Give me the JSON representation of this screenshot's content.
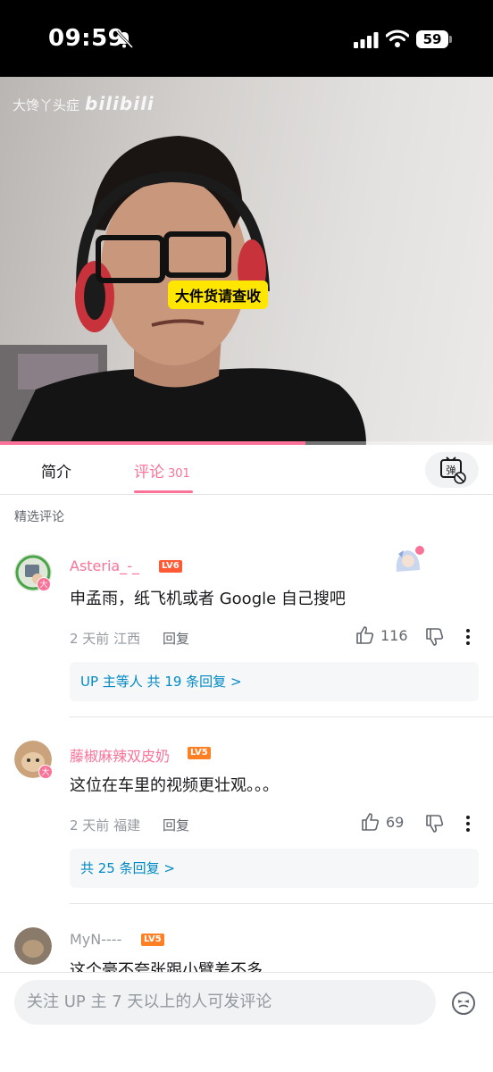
{
  "status_bar": {
    "time": "09:59",
    "battery": "59"
  },
  "video": {
    "watermark_text": "大馋丫头症",
    "watermark_logo": "bilibili",
    "caption": "大件货请查收",
    "progress_fraction": 0.62
  },
  "tabs": {
    "intro": "简介",
    "comments": "评论",
    "comments_count": "301",
    "danmaku_icon": "danmaku-toggle-icon"
  },
  "section_title": "精选评论",
  "comments": [
    {
      "username": "Asteria_-_",
      "level": "LV6",
      "text": "申孟雨，纸飞机或者 Google 自己搜吧",
      "time": "2 天前",
      "location": "江西",
      "reply_label": "回复",
      "likes": "116",
      "replies_summary": "UP 主等人 共 19 条回复 >"
    },
    {
      "username": "藤椒麻辣双皮奶",
      "level": "LV5",
      "text": "这位在车里的视频更壮观。。。",
      "time": "2 天前",
      "location": "福建",
      "reply_label": "回复",
      "likes": "69",
      "replies_summary": "共 25 条回复 >"
    },
    {
      "username": "MyN----",
      "level": "LV5",
      "text": "这个豪不夸张跟小臂差不多"
    }
  ],
  "bottom": {
    "input_placeholder": "关注 UP 主 7 天以上的人可发评论"
  },
  "colors": {
    "accent": "#fb7299",
    "link": "#008ac5",
    "lv6": "#ff5a36",
    "lv5": "#ff7f24"
  }
}
